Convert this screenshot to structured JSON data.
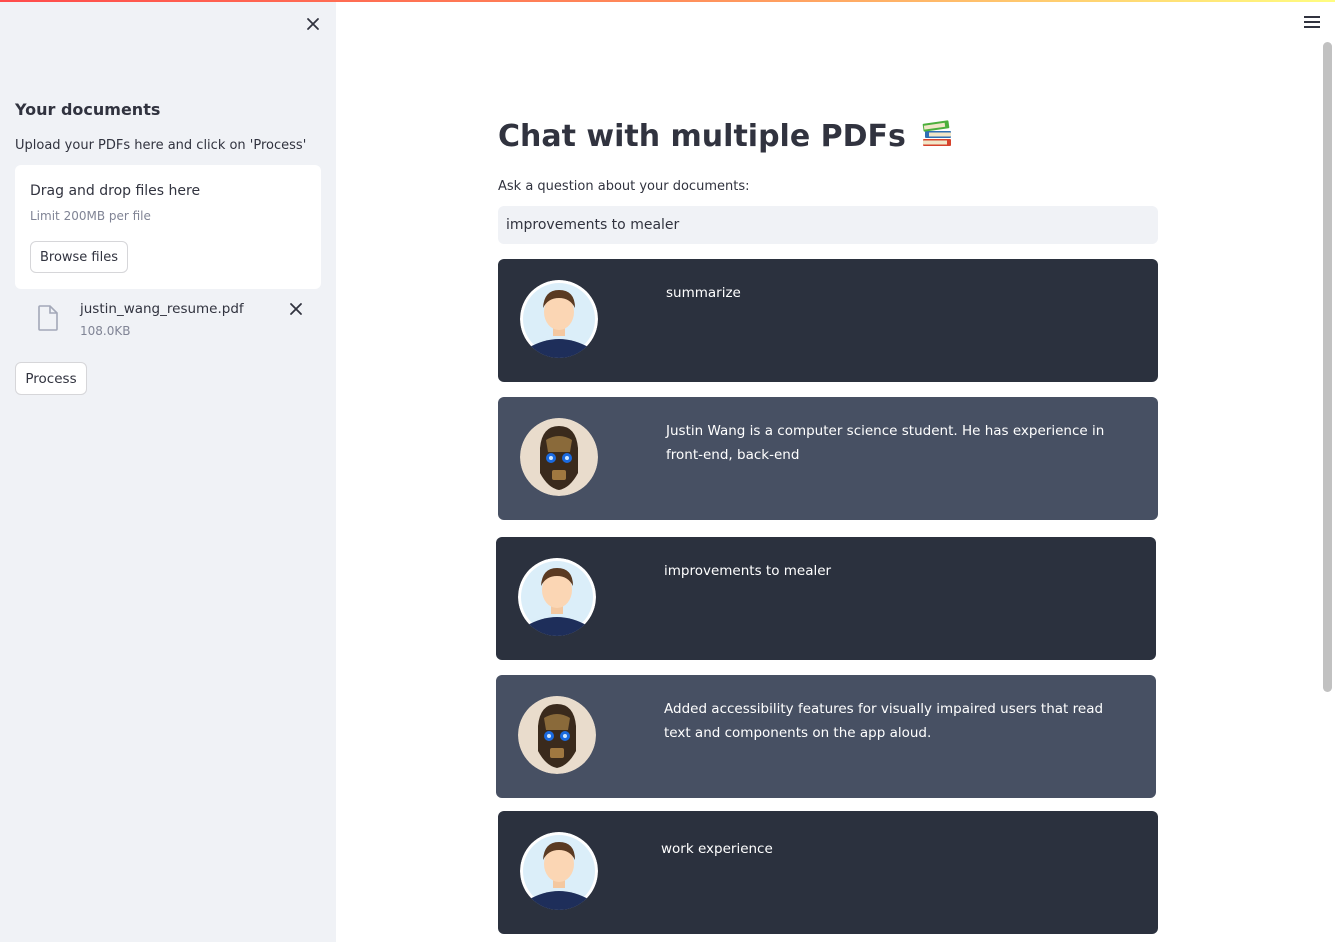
{
  "sidebar": {
    "heading": "Your documents",
    "upload_label": "Upload your PDFs here and click on 'Process'",
    "dropzone": {
      "title": "Drag and drop files here",
      "limit": "Limit 200MB per file",
      "browse_label": "Browse files"
    },
    "file": {
      "name": "justin_wang_resume.pdf",
      "size": "108.0KB"
    },
    "process_label": "Process"
  },
  "main": {
    "title": "Chat with multiple PDFs",
    "title_icon": "books-icon",
    "input_label": "Ask a question about your documents:",
    "input_value": "improvements to mealer",
    "messages": [
      {
        "role": "user",
        "text": "summarize"
      },
      {
        "role": "bot",
        "text": "Justin Wang is a computer science student. He has experience in front-end, back-end"
      },
      {
        "role": "user",
        "text": "improvements to mealer"
      },
      {
        "role": "bot",
        "text": "Added accessibility features for visually impaired users that read text and components on the app aloud."
      },
      {
        "role": "user",
        "text": "work experience"
      }
    ]
  },
  "colors": {
    "sidebar_bg": "#f0f2f6",
    "user_msg_bg": "#2b313e",
    "bot_msg_bg": "#475063",
    "text": "#31333f",
    "muted": "#808495"
  }
}
